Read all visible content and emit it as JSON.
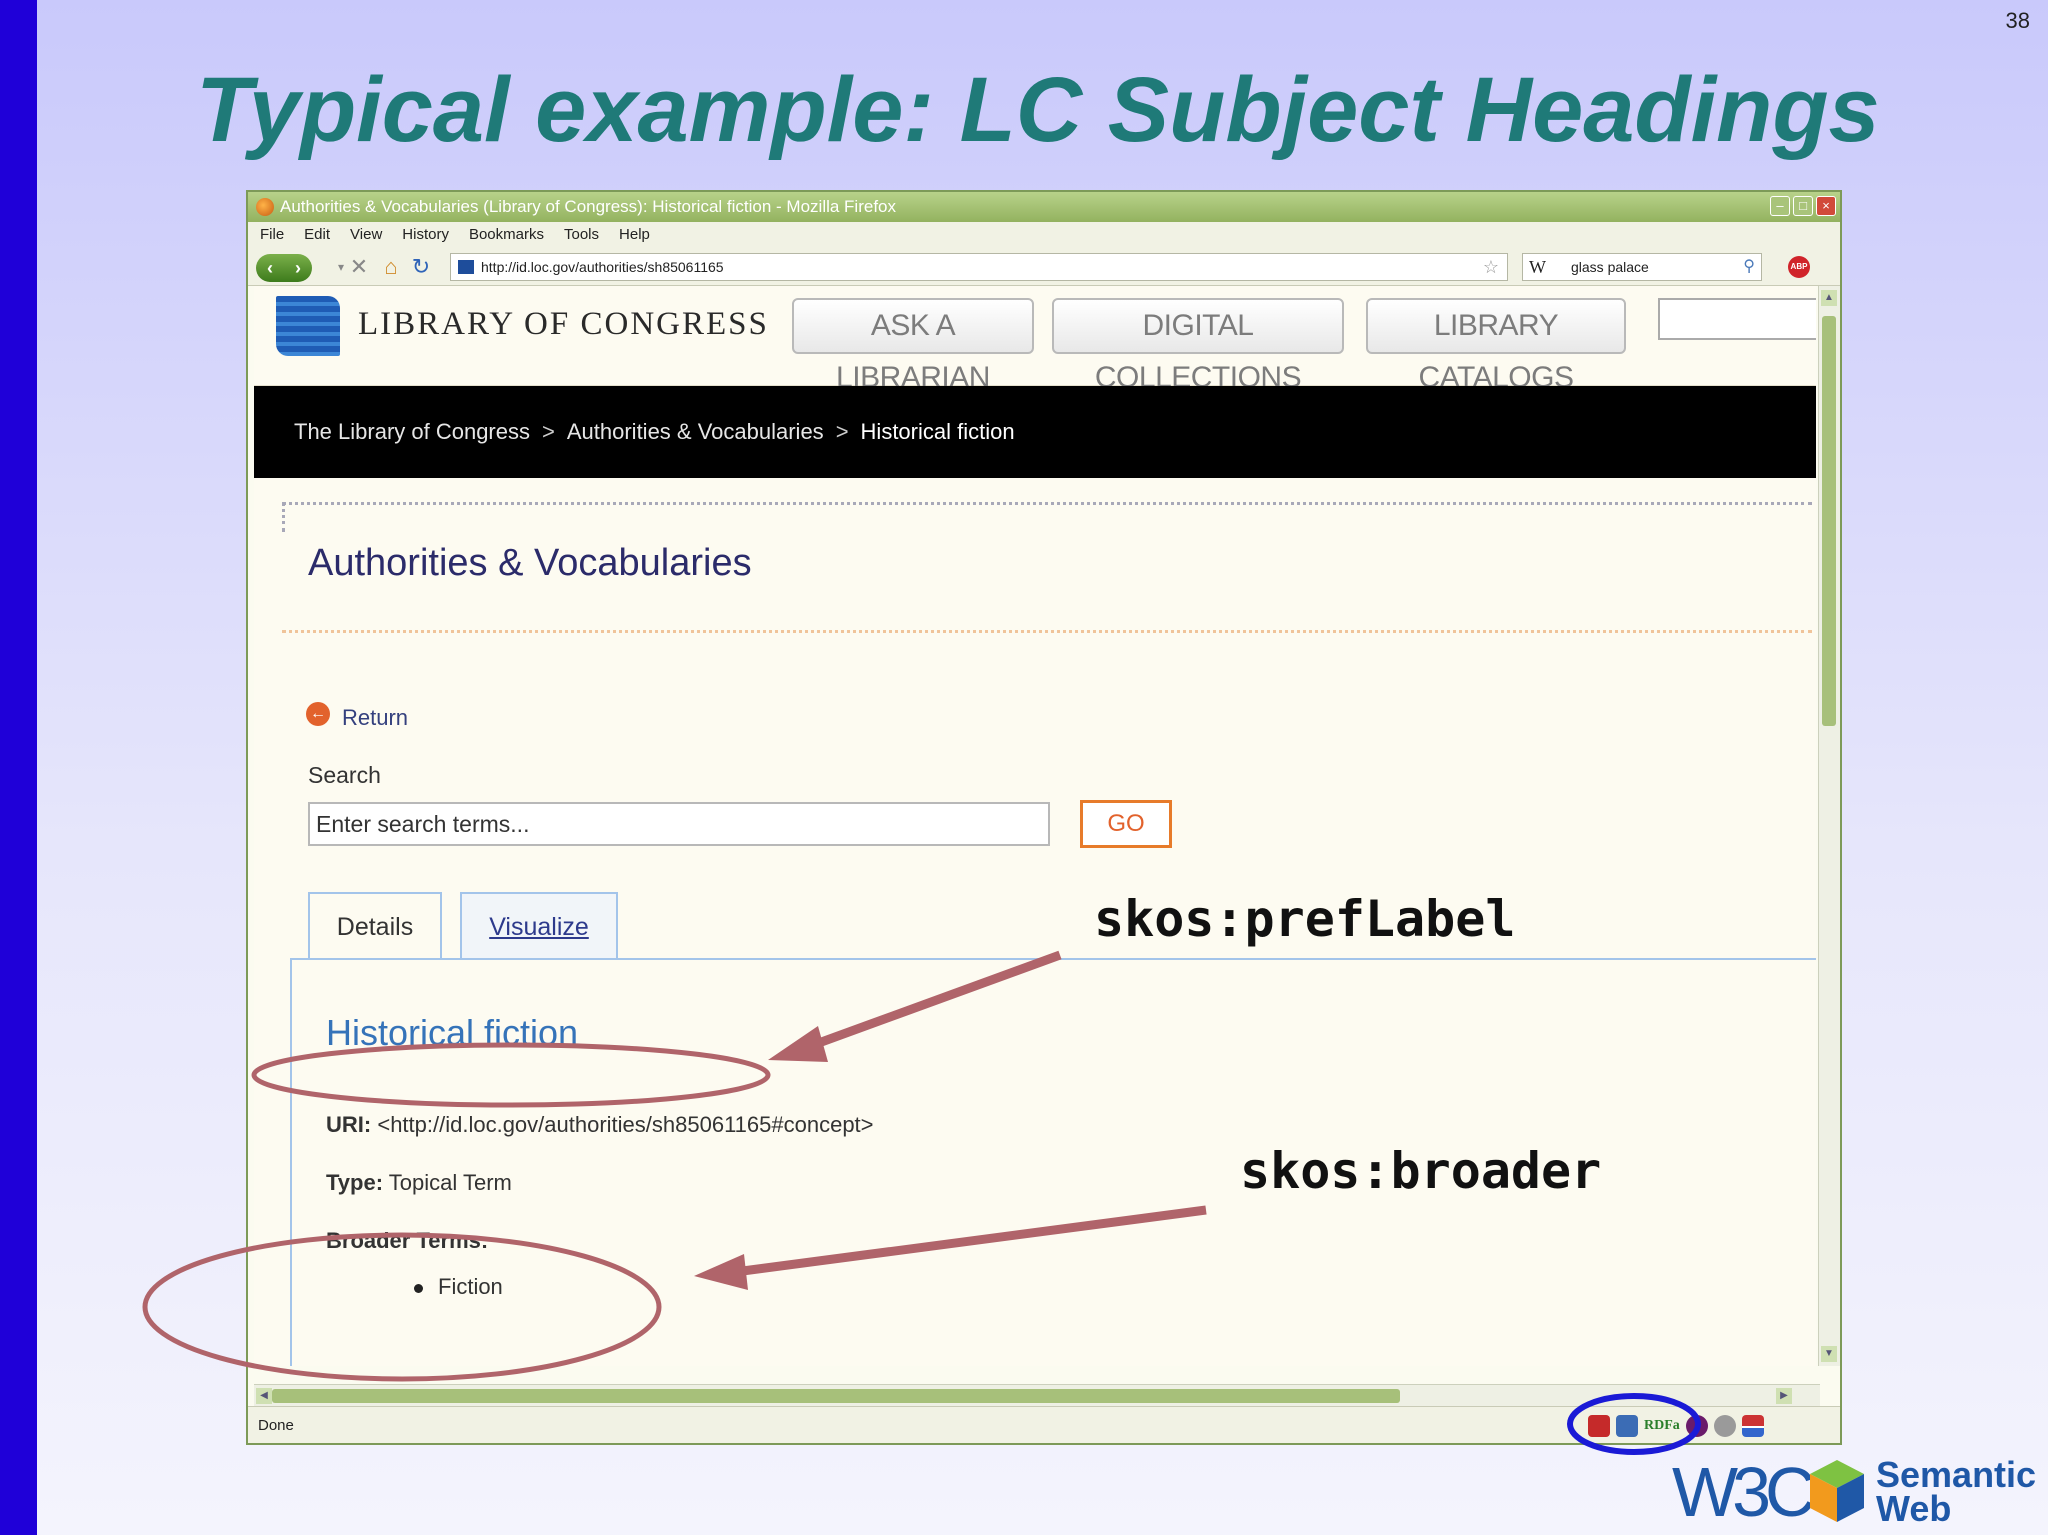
{
  "slide": {
    "number": "38",
    "title": "Typical example: LC Subject Headings"
  },
  "browser": {
    "title": "Authorities & Vocabularies (Library of Congress): Historical fiction - Mozilla Firefox",
    "menu": [
      "File",
      "Edit",
      "View",
      "History",
      "Bookmarks",
      "Tools",
      "Help"
    ],
    "url": "http://id.loc.gov/authorities/sh85061165",
    "search_engine": "W",
    "search_value": "glass palace",
    "status": "Done",
    "rdfa_label": "RDFa"
  },
  "site": {
    "name": "LIBRARY OF CONGRESS",
    "buttons": [
      "ASK A LIBRARIAN",
      "DIGITAL COLLECTIONS",
      "LIBRARY CATALOGS"
    ],
    "breadcrumb": [
      "The Library of Congress",
      "Authorities & Vocabularies",
      "Historical fiction"
    ],
    "breadcrumb_sep": ">",
    "section_title": "Authorities & Vocabularies",
    "return_label": "Return",
    "search_label": "Search",
    "search_placeholder": "Enter search terms...",
    "go_label": "GO",
    "tabs": [
      "Details",
      "Visualize"
    ],
    "term": "Historical fiction",
    "uri_label": "URI:",
    "uri_value": "<http://id.loc.gov/authorities/sh85061165#concept>",
    "type_label": "Type:",
    "type_value": "Topical Term",
    "broader_label": "Broader Terms:",
    "broader_items": [
      "Fiction"
    ]
  },
  "annotations": {
    "pref_label": "skos:prefLabel",
    "broader": "skos:broader",
    "color": "#b0646a"
  },
  "logo": {
    "w3c": "W3C",
    "sw_line1": "Semantic",
    "sw_line2": "Web"
  }
}
